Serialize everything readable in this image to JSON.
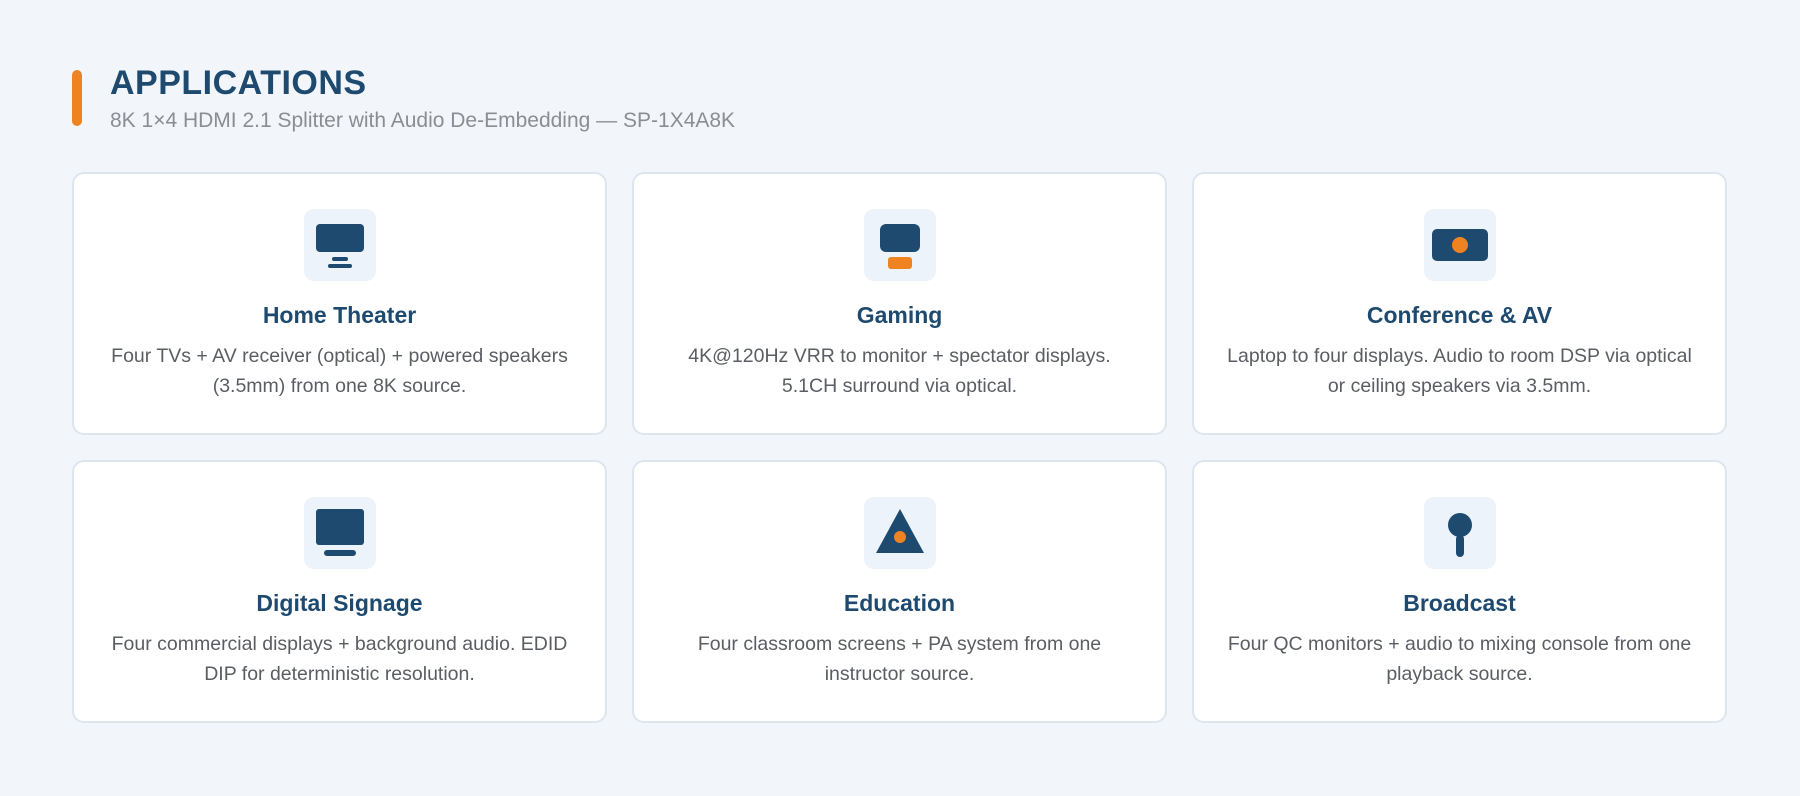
{
  "header": {
    "title": "APPLICATIONS",
    "subtitle": "8K 1×4 HDMI 2.1 Splitter with Audio De-Embedding — SP-1X4A8K"
  },
  "colors": {
    "primary": "#1d4a6e",
    "accent": "#f08321",
    "background": "#f2f6fa",
    "icon_tile": "#edf3fa"
  },
  "cards": [
    {
      "icon": "monitor-stand-icon",
      "title": "Home Theater",
      "description": "Four TVs + AV receiver (optical) + powered speakers (3.5mm) from one 8K source."
    },
    {
      "icon": "game-controller-icon",
      "title": "Gaming",
      "description": "4K@120Hz VRR to monitor + spectator displays. 5.1CH surround via optical."
    },
    {
      "icon": "projector-icon",
      "title": "Conference & AV",
      "description": "Laptop to four displays. Audio to room DSP via optical or ceiling speakers via 3.5mm."
    },
    {
      "icon": "display-icon",
      "title": "Digital Signage",
      "description": "Four commercial displays + background audio. EDID DIP for deterministic resolution."
    },
    {
      "icon": "triangle-icon",
      "title": "Education",
      "description": "Four classroom screens + PA system from one instructor source."
    },
    {
      "icon": "microphone-icon",
      "title": "Broadcast",
      "description": "Four QC monitors + audio to mixing console from one playback source."
    }
  ]
}
